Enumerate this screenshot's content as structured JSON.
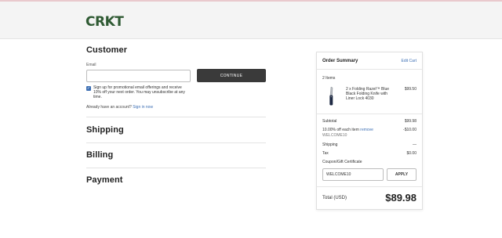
{
  "brand": {
    "logo": "CRKT",
    "color": "#2f5a33"
  },
  "customer": {
    "heading": "Customer",
    "email_label": "Email",
    "email_value": "",
    "continue_label": "CONTINUE",
    "promo_text": "Sign up for promotional email offerings and receive 10% off your next order. You may unsubscribe at any time.",
    "promo_checked": true,
    "already_text": "Already have an account?",
    "sign_in_label": "Sign in now"
  },
  "sections": [
    "Shipping",
    "Billing",
    "Payment"
  ],
  "summary": {
    "title": "Order Summary",
    "edit_label": "Edit Cart",
    "items_count": "2 Items",
    "product": {
      "name": "2 x Folding Razel™ Blue Black Folding Knife with Liner Lock 4030",
      "price": "$99.50",
      "icon": "knife-image"
    },
    "subtotal_label": "Subtotal",
    "subtotal_value": "$99.98",
    "discount_label": "10.00% off each item",
    "remove_label": "remove",
    "discount_value": "-$10.00",
    "discount_code": "WELCOME10",
    "shipping_label": "Shipping",
    "shipping_value": "—",
    "tax_label": "Tax",
    "tax_value": "$0.00",
    "coupon_link": "Coupon/Gift Certificate",
    "coupon_value": "WELCOME10",
    "apply_label": "APPLY",
    "total_label": "Total (USD)",
    "total_value": "$89.98"
  }
}
